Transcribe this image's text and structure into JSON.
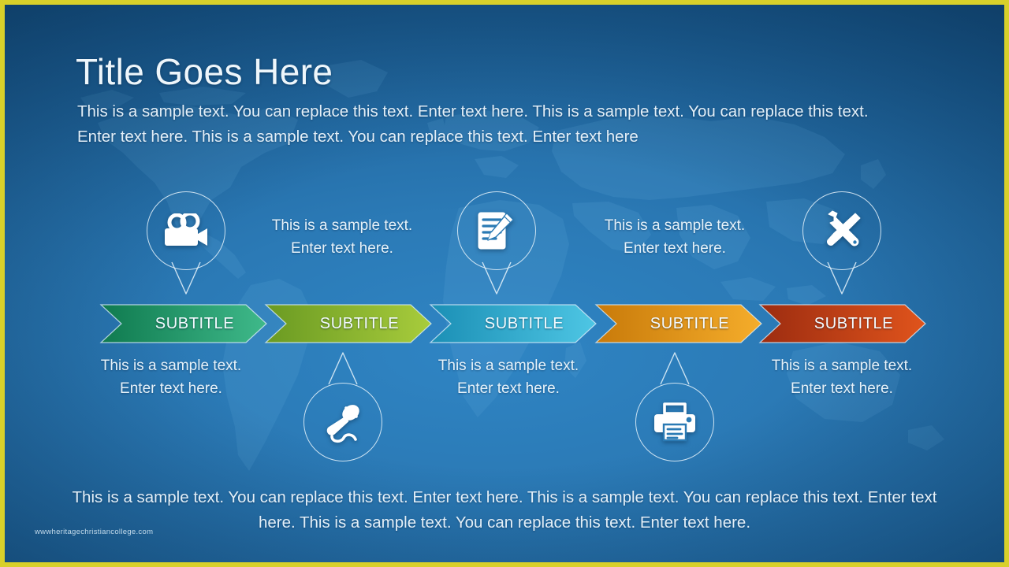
{
  "slide": {
    "title": "Title Goes Here",
    "intro": "This is a sample text. You can replace this text. Enter text here. This is a sample text. You can replace this text. Enter text here. This is a sample text. You can replace this text. Enter text here",
    "footer": "This is a sample text. You can replace this text. Enter text here. This is a sample text. You can replace this text. Enter text here. This is a sample text. You can replace this text. Enter text here.",
    "watermark": "wwwheritagechristiancollege.com",
    "border_color": "#d8d02a",
    "background_colors": [
      "#2f85c4",
      "#0f416d"
    ]
  },
  "steps": [
    {
      "subtitle": "SUBTITLE",
      "description": "This is a sample text. Enter text here.",
      "icon": "video-camera-icon",
      "icon_position": "top",
      "description_position": "bottom",
      "color_start": "#0f7a4f",
      "color_end": "#3fb98a"
    },
    {
      "subtitle": "SUBTITLE",
      "description": "This is a sample text. Enter text here.",
      "icon": "microphone-icon",
      "icon_position": "bottom",
      "description_position": "top",
      "color_start": "#6a9a22",
      "color_end": "#a8cc3c"
    },
    {
      "subtitle": "SUBTITLE",
      "description": "This is a sample text. Enter text here.",
      "icon": "notepad-pencil-icon",
      "icon_position": "top",
      "description_position": "bottom",
      "color_start": "#1b8fb5",
      "color_end": "#4ec6e4"
    },
    {
      "subtitle": "SUBTITLE",
      "description": "This is a sample text. Enter text here.",
      "icon": "printer-icon",
      "icon_position": "bottom",
      "description_position": "top",
      "color_start": "#c87a0a",
      "color_end": "#f5ad2b"
    },
    {
      "subtitle": "SUBTITLE",
      "description": "This is a sample text. Enter text here.",
      "icon": "tools-icon",
      "icon_position": "top",
      "description_position": "bottom",
      "color_start": "#9c2c10",
      "color_end": "#e0541c"
    }
  ]
}
